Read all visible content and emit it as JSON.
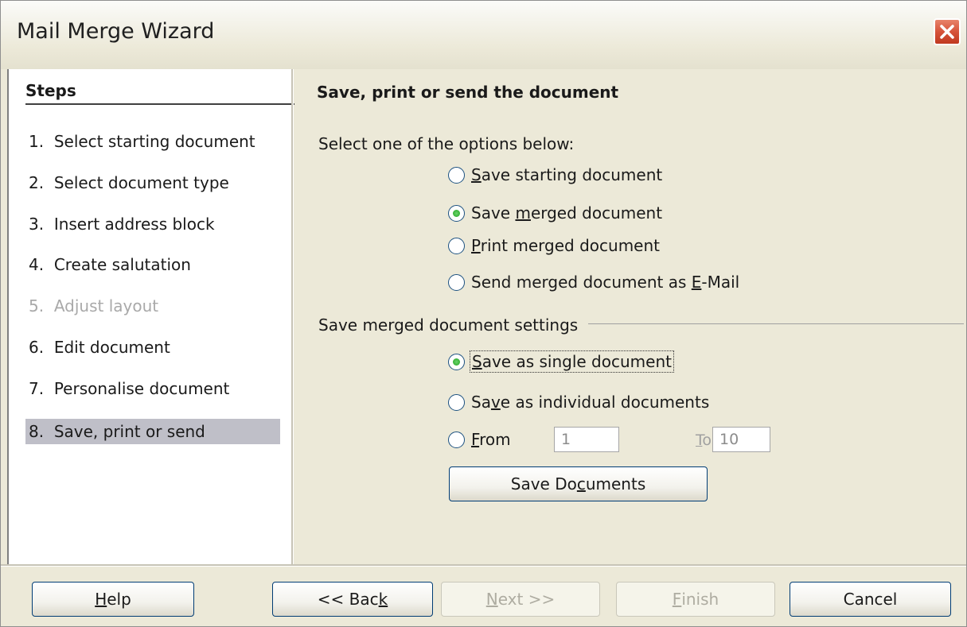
{
  "window": {
    "title": "Mail Merge Wizard",
    "close_icon": "close-icon",
    "close_color": "#d6533a"
  },
  "steps": {
    "heading": "Steps",
    "items": [
      {
        "num": "1.",
        "label": "Select starting document",
        "state": "normal"
      },
      {
        "num": "2.",
        "label": "Select document type",
        "state": "normal"
      },
      {
        "num": "3.",
        "label": "Insert address block",
        "state": "normal"
      },
      {
        "num": "4.",
        "label": "Create salutation",
        "state": "normal"
      },
      {
        "num": "5.",
        "label": "Adjust layout",
        "state": "disabled"
      },
      {
        "num": "6.",
        "label": "Edit document",
        "state": "normal"
      },
      {
        "num": "7.",
        "label": "Personalise document",
        "state": "normal"
      },
      {
        "num": "8.",
        "label": "Save, print or send",
        "state": "active"
      }
    ]
  },
  "content": {
    "title": "Save, print or send the document",
    "options_label": "Select one of the options below:",
    "options": [
      {
        "pre": "",
        "mnemonic": "S",
        "post": "ave starting document",
        "selected": false
      },
      {
        "pre": "Save ",
        "mnemonic": "m",
        "post": "erged document",
        "selected": true
      },
      {
        "pre": "",
        "mnemonic": "P",
        "post": "rint merged document",
        "selected": false
      },
      {
        "pre": "Send merged document as ",
        "mnemonic": "E",
        "post": "-Mail",
        "selected": false
      }
    ],
    "settings_label": "Save merged document settings",
    "settings": {
      "single": {
        "pre": "",
        "mnemonic": "S",
        "post": "ave as single document",
        "selected": true
      },
      "individual": {
        "pre": "Sa",
        "mnemonic": "v",
        "post": "e as individual documents",
        "selected": false
      },
      "from": {
        "pre": "",
        "mnemonic": "F",
        "post": "rom",
        "selected": false
      },
      "from_value": "1",
      "to_pre": "",
      "to_mnemonic": "T",
      "to_post": "o",
      "to_value": "10"
    },
    "save_button": {
      "pre": "Save Do",
      "mnemonic": "c",
      "post": "uments"
    }
  },
  "footer": {
    "help": {
      "pre": "",
      "mnemonic": "H",
      "post": "elp"
    },
    "back": {
      "pre": "<< Bac",
      "mnemonic": "k",
      "post": ""
    },
    "next": {
      "pre": "",
      "mnemonic": "N",
      "post": "ext >>"
    },
    "finish": {
      "pre": "",
      "mnemonic": "F",
      "post": "inish"
    },
    "cancel": "Cancel"
  }
}
